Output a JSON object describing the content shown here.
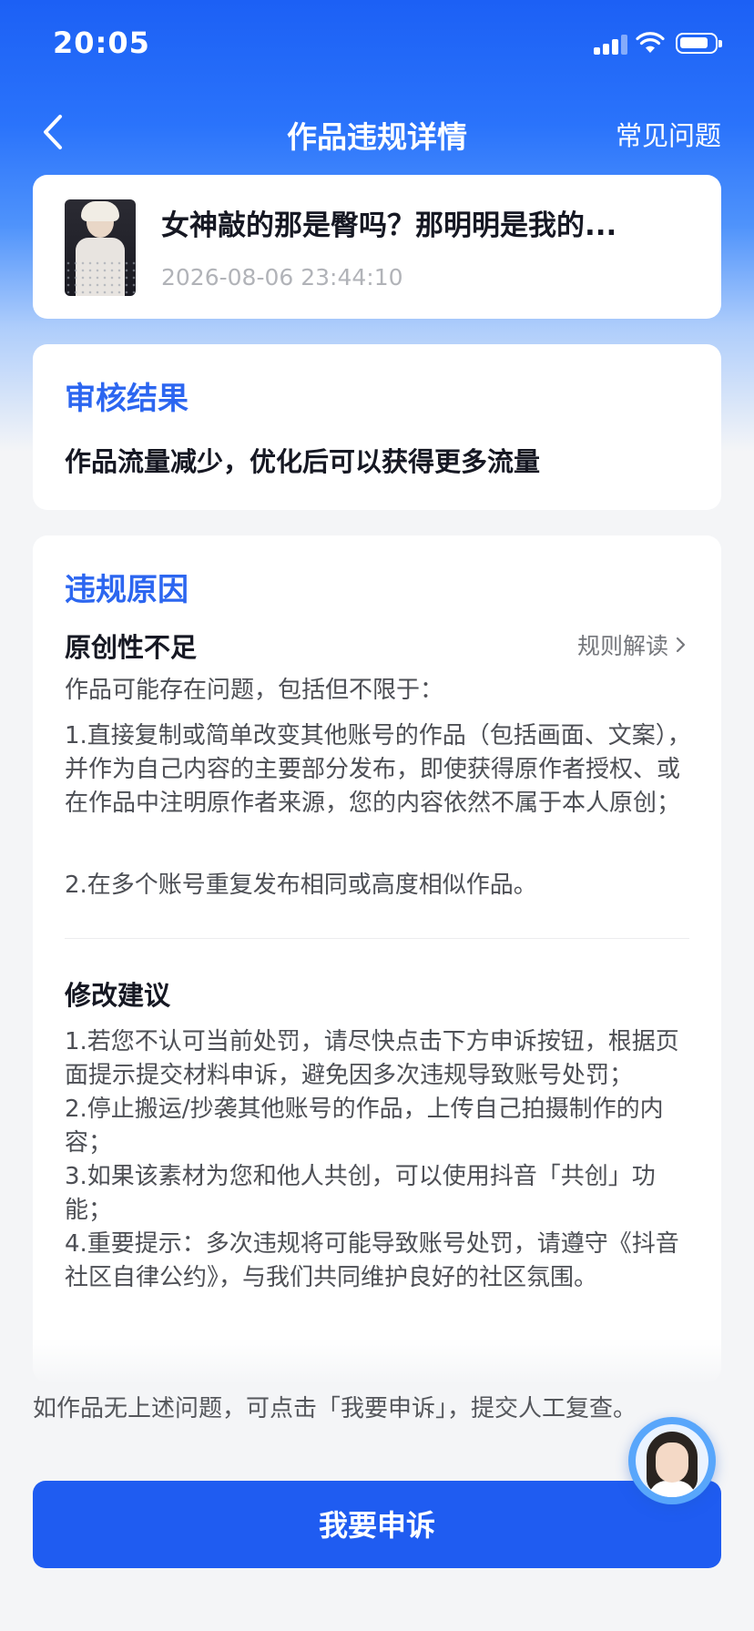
{
  "status": {
    "time": "20:05"
  },
  "nav": {
    "title": "作品违规详情",
    "faq": "常见问题"
  },
  "work": {
    "title": "女神敲的那是臀吗？那明明是我的...",
    "time": "2026-08-06 23:44:10"
  },
  "result": {
    "title": "审核结果",
    "text": "作品流量减少，优化后可以获得更多流量"
  },
  "reason": {
    "title": "违规原因",
    "name": "原创性不足",
    "rule_link": "规则解读",
    "intro": "作品可能存在问题，包括但不限于：",
    "items": [
      "1.直接复制或简单改变其他账号的作品（包括画面、文案），并作为自己内容的主要部分发布，即使获得原作者授权、或在作品中注明原作者来源，您的内容依然不属于本人原创；",
      "2.在多个账号重复发布相同或高度相似作品。"
    ],
    "suggest_title": "修改建议",
    "suggestions": [
      "1.若您不认可当前处罚，请尽快点击下方申诉按钮，根据页面提示提交材料申诉，避免因多次违规导致账号处罚；",
      "2.停止搬运/抄袭其他账号的作品，上传自己拍摄制作的内容；",
      "3.如果该素材为您和他人共创，可以使用抖音「共创」功能；",
      "4.重要提示：多次违规将可能导致账号处罚，请遵守《抖音社区自律公约》，与我们共同维护良好的社区氛围。"
    ]
  },
  "hint": "如作品无上述问题，可点击「我要申诉」，提交人工复查。",
  "appeal_button": "我要申诉",
  "icons": {
    "back": "chevron-left-icon",
    "rule_chevron": "chevron-right-icon",
    "assistant": "assistant-avatar-icon"
  },
  "colors": {
    "primary": "#1f5cf1",
    "section_title": "#2c66f0"
  }
}
